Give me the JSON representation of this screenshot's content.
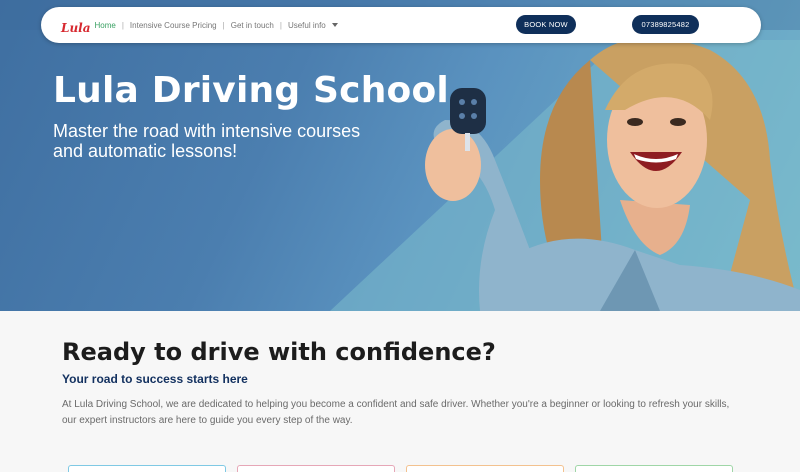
{
  "nav": {
    "logo_text": "Lula",
    "links": [
      "Home",
      "Intensive Course Pricing",
      "Get in touch",
      "Useful info"
    ],
    "book_label": "BOOK NOW",
    "phone_label": "07389825482"
  },
  "hero": {
    "title": "Lula Driving School",
    "subtitle": "Master the road with intensive courses and automatic lessons!"
  },
  "content": {
    "heading": "Ready to drive with confidence?",
    "subheading": "Your road to success starts here",
    "paragraph": "At Lula Driving School, we are dedicated to helping you become a confident and safe driver. Whether you're a beginner or looking to refresh your skills, our expert instructors are here to guide you every step of the way."
  },
  "colors": {
    "brand_red": "#d7282f",
    "nav_active": "#3aa163",
    "button_navy": "#0f2f5a",
    "subheading_navy": "#12305f"
  }
}
